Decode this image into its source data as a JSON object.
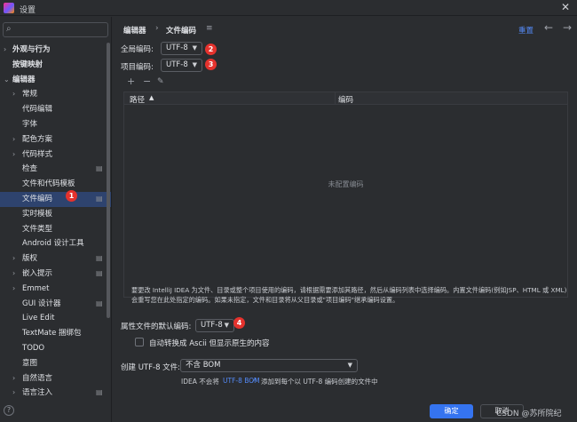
{
  "window": {
    "title": "设置"
  },
  "sidebar": {
    "search_placeholder": "",
    "items": [
      {
        "label": "外观与行为",
        "arrow": "›",
        "bold": true,
        "indent": 0
      },
      {
        "label": "按键映射",
        "arrow": "",
        "bold": true,
        "indent": 0
      },
      {
        "label": "编辑器",
        "arrow": "⌄",
        "bold": true,
        "indent": 0
      },
      {
        "label": "常规",
        "arrow": "›",
        "bold": false,
        "indent": 1
      },
      {
        "label": "代码编辑",
        "arrow": "",
        "bold": false,
        "indent": 1
      },
      {
        "label": "字体",
        "arrow": "",
        "bold": false,
        "indent": 1
      },
      {
        "label": "配色方案",
        "arrow": "›",
        "bold": false,
        "indent": 1
      },
      {
        "label": "代码样式",
        "arrow": "›",
        "bold": false,
        "indent": 1
      },
      {
        "label": "检查",
        "arrow": "",
        "bold": false,
        "indent": 1,
        "cfg": true
      },
      {
        "label": "文件和代码模板",
        "arrow": "",
        "bold": false,
        "indent": 1
      },
      {
        "label": "文件编码",
        "arrow": "",
        "bold": false,
        "indent": 1,
        "cfg": true,
        "selected": true
      },
      {
        "label": "实时模板",
        "arrow": "",
        "bold": false,
        "indent": 1
      },
      {
        "label": "文件类型",
        "arrow": "",
        "bold": false,
        "indent": 1
      },
      {
        "label": "Android 设计工具",
        "arrow": "",
        "bold": false,
        "indent": 1
      },
      {
        "label": "版权",
        "arrow": "›",
        "bold": false,
        "indent": 1,
        "cfg": true
      },
      {
        "label": "嵌入提示",
        "arrow": "›",
        "bold": false,
        "indent": 1,
        "cfg": true
      },
      {
        "label": "Emmet",
        "arrow": "›",
        "bold": false,
        "indent": 1
      },
      {
        "label": "GUI 设计器",
        "arrow": "",
        "bold": false,
        "indent": 1,
        "cfg": true
      },
      {
        "label": "Live Edit",
        "arrow": "",
        "bold": false,
        "indent": 1
      },
      {
        "label": "TextMate 捆绑包",
        "arrow": "",
        "bold": false,
        "indent": 1
      },
      {
        "label": "TODO",
        "arrow": "",
        "bold": false,
        "indent": 1
      },
      {
        "label": "意图",
        "arrow": "",
        "bold": false,
        "indent": 1
      },
      {
        "label": "自然语言",
        "arrow": "›",
        "bold": false,
        "indent": 1
      },
      {
        "label": "语言注入",
        "arrow": "›",
        "bold": false,
        "indent": 1,
        "cfg": true
      }
    ]
  },
  "breadcrumb": {
    "parent": "编辑器",
    "separator": "›",
    "current": "文件编码",
    "icon": "≡"
  },
  "header": {
    "reset": "重置",
    "back": "←",
    "forward": "→"
  },
  "global_encoding": {
    "label": "全局编码:",
    "value": "UTF-8"
  },
  "project_encoding": {
    "label": "项目编码:",
    "value": "UTF-8"
  },
  "table": {
    "tools": {
      "add": "+",
      "remove": "−",
      "edit": "✎"
    },
    "col_path": "路径",
    "sort_arrow": "▲",
    "col_encoding": "编码",
    "empty_text": "未配置编码"
  },
  "note": "要更改 IntelliJ IDEA 为文件、目录或整个项目使用的编码，请根据需要添加其路径，然后从编码列表中选择编码。内置文件编码(例如JSP、HTML 或 XML)会重写您在此处指定的编码。如果未指定，文件和目录将从父目录或\"项目编码\"继承编码设置。",
  "properties": {
    "label": "属性文件的默认编码:",
    "value": "UTF-8"
  },
  "transparent_ascii": {
    "label": "自动转换成 Ascii 但显示原生的内容",
    "checked": false
  },
  "bom": {
    "label": "创建 UTF-8 文件:",
    "value": "不含 BOM"
  },
  "bom_hint": {
    "prefix": "IDEA 不会将",
    "link": "UTF-8 BOM",
    "ext": "↗",
    "suffix": "添加到每个以 UTF-8 编码创建的文件中"
  },
  "footer": {
    "ok": "确定",
    "cancel": "取消",
    "watermark": "CSDN @苏所院纪",
    "help": "?"
  },
  "annotations": {
    "b1": "1",
    "b2": "2",
    "b3": "3",
    "b4": "4"
  },
  "colors": {
    "accent": "#3574f0",
    "selection": "#2e436e",
    "badge": "#e5322d",
    "link": "#548af7"
  }
}
